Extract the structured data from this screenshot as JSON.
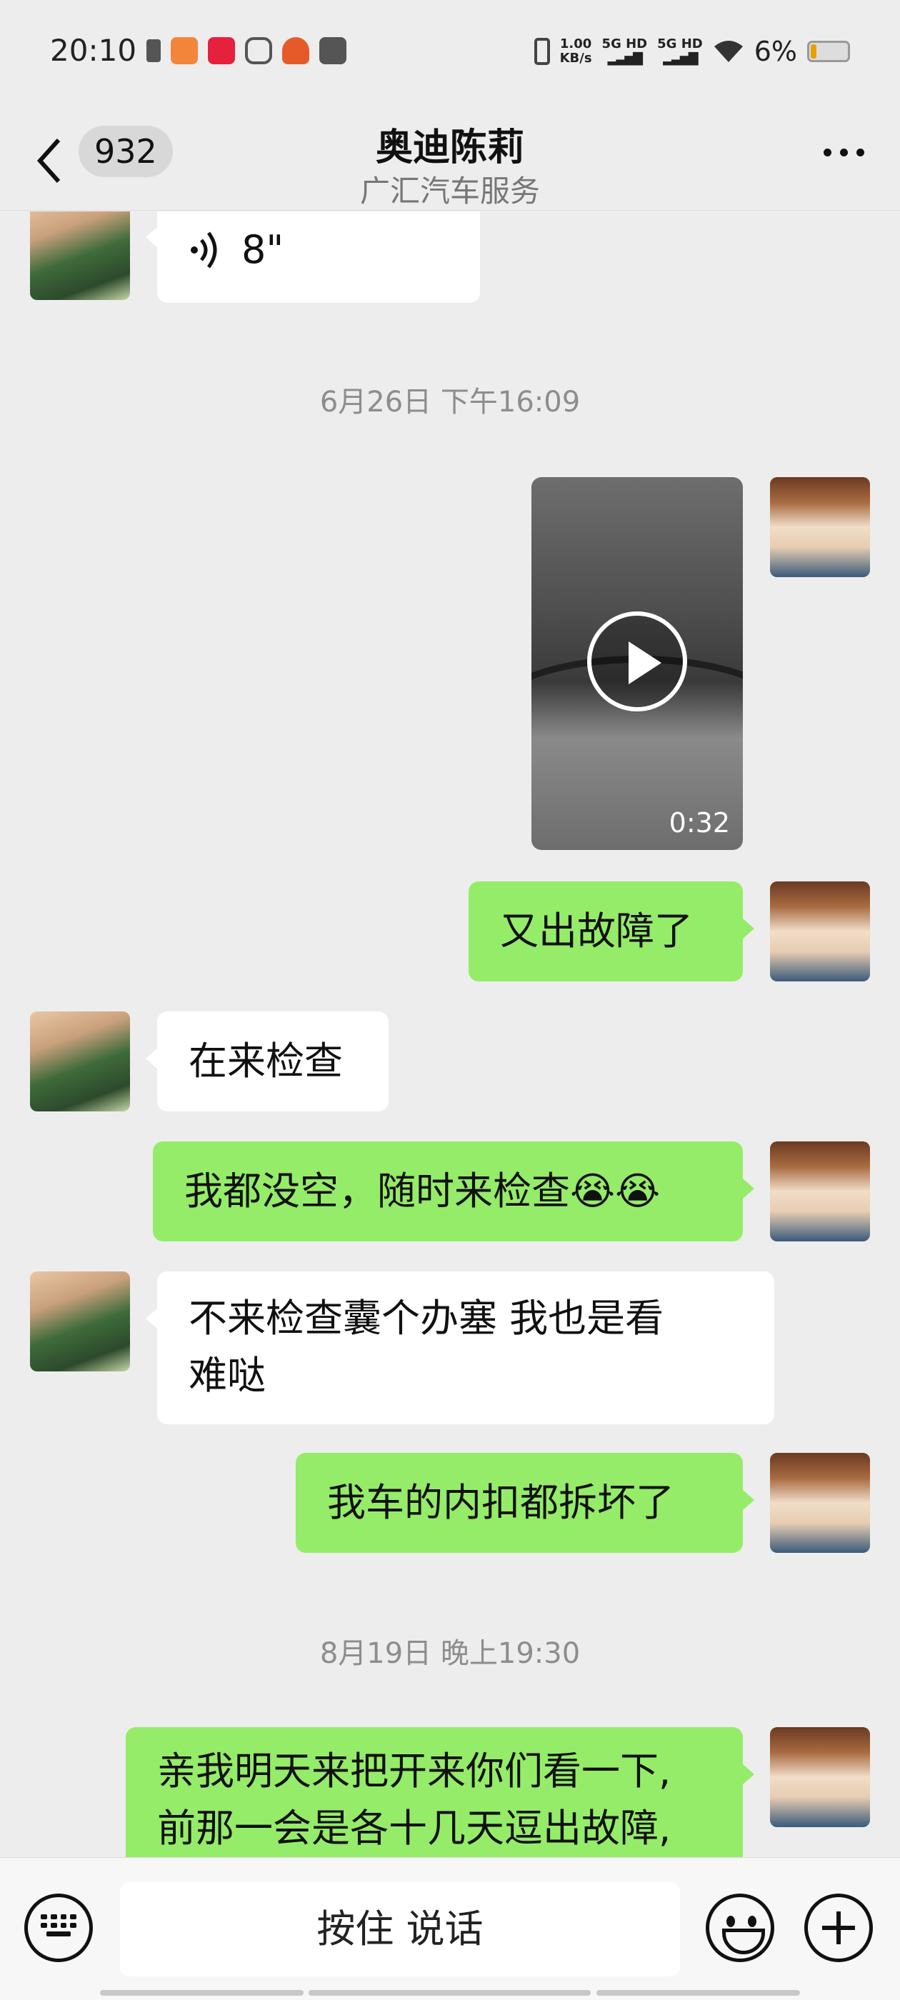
{
  "status_bar": {
    "time": "20:10",
    "net_speed_value": "1.00",
    "net_speed_unit": "KB/s",
    "sim1_label": "5G HD",
    "sim2_label": "5G HD",
    "battery_percent": "6%",
    "app_icons": [
      "battery-saver-icon",
      "pinduoduo-icon",
      "kuaishou-icon",
      "search-app-icon",
      "taobao-icon",
      "telegram-icon"
    ]
  },
  "header": {
    "back_icon": "chevron-left-icon",
    "unread_count": "932",
    "title": "奥迪陈莉",
    "subtitle": "广汇汽车服务",
    "more_icon": "more-dots-icon"
  },
  "messages": {
    "voice_duration": "8\"",
    "timestamp_1": "6月26日 下午16:09",
    "video_duration": "0:32",
    "msg_1": "又出故障了",
    "msg_2": "在来检查",
    "msg_3": "我都没空，随时来检查",
    "msg_3_emoji": "😭😭",
    "msg_4_line1": "不来检查囊个办塞  我也是看",
    "msg_4_line2": "难哒",
    "msg_5": "我车的内扣都拆坏了",
    "timestamp_2": "8月19日 晚上19:30",
    "msg_6_line1": "亲我明天来把开来你们看一下,",
    "msg_6_line2": "前那一会是各十几天逗出故障,"
  },
  "input_bar": {
    "keyboard_icon": "keyboard-icon",
    "hold_to_talk": "按住 说话",
    "emoji_icon": "emoji-icon",
    "plus_icon": "plus-icon"
  },
  "colors": {
    "chat_background": "#ededed",
    "own_bubble": "#95ec69",
    "other_bubble": "#ffffff",
    "timestamp_text": "#8d8d8d"
  }
}
